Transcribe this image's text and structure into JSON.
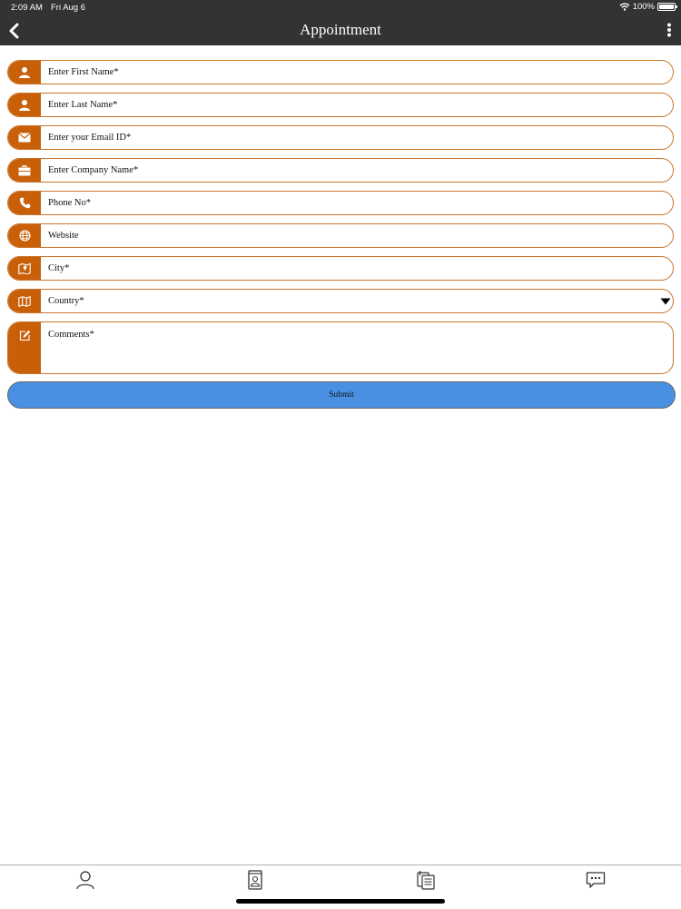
{
  "status_bar": {
    "time": "2:09 AM",
    "date": "Fri Aug 6",
    "battery": "100%",
    "battery_level": 1.0
  },
  "nav": {
    "title": "Appointment",
    "back_icon": "chevron-left-icon",
    "more_icon": "more-vertical-icon"
  },
  "form": {
    "first_name": {
      "placeholder": "Enter First Name*",
      "icon": "person-icon"
    },
    "last_name": {
      "placeholder": "Enter Last Name*",
      "icon": "person-icon"
    },
    "email": {
      "placeholder": "Enter your Email ID*",
      "icon": "envelope-icon"
    },
    "company": {
      "placeholder": "Enter Company Name*",
      "icon": "briefcase-icon"
    },
    "phone": {
      "placeholder": "Phone No*",
      "icon": "phone-icon"
    },
    "website": {
      "placeholder": "Website",
      "icon": "globe-icon"
    },
    "city": {
      "placeholder": "City*",
      "icon": "city-map-icon"
    },
    "country": {
      "value": "Country*",
      "icon": "map-icon"
    },
    "comments": {
      "placeholder": "Comments*",
      "icon": "edit-icon"
    },
    "submit_label": "Submit"
  },
  "tabs": [
    "profile-tab-icon",
    "contact-card-tab-icon",
    "documents-tab-icon",
    "chat-tab-icon"
  ],
  "colors": {
    "bar": "#333333",
    "accent": "#c8600a",
    "border": "#c8742a",
    "submit": "#4a90e2"
  }
}
